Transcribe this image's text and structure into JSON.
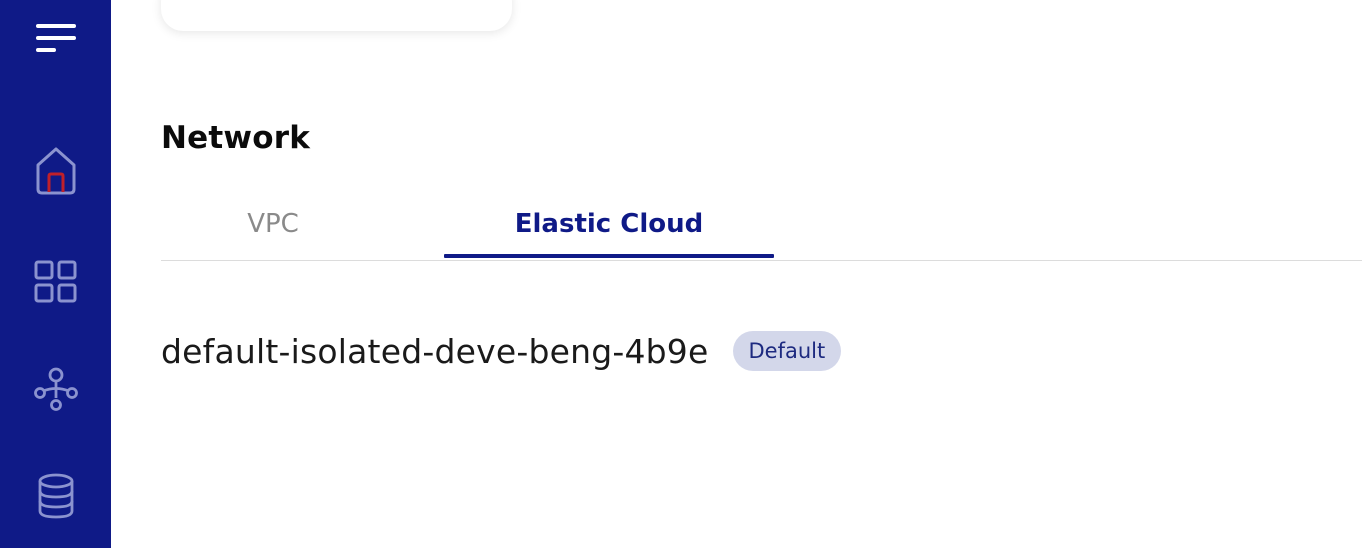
{
  "sidebar": {
    "icons": {
      "menu": "menu-icon",
      "home": "home-icon",
      "dashboard": "grid-icon",
      "network": "network-icon",
      "database": "database-icon"
    },
    "colors": {
      "background": "#0f1a87",
      "icon": "#8b93cf",
      "menu_icon": "#ffffff",
      "home_accent": "#c0202a"
    }
  },
  "main": {
    "section_title": "Network",
    "tabs": [
      {
        "label": "VPC",
        "active": false
      },
      {
        "label": "Elastic Cloud",
        "active": true
      }
    ],
    "network": {
      "name": "default-isolated-deve-beng-4b9e",
      "badge": "Default"
    },
    "colors": {
      "accent": "#0f1a87",
      "inactive_tab": "#8a8a8a",
      "badge_bg": "#d3d7ea"
    }
  }
}
